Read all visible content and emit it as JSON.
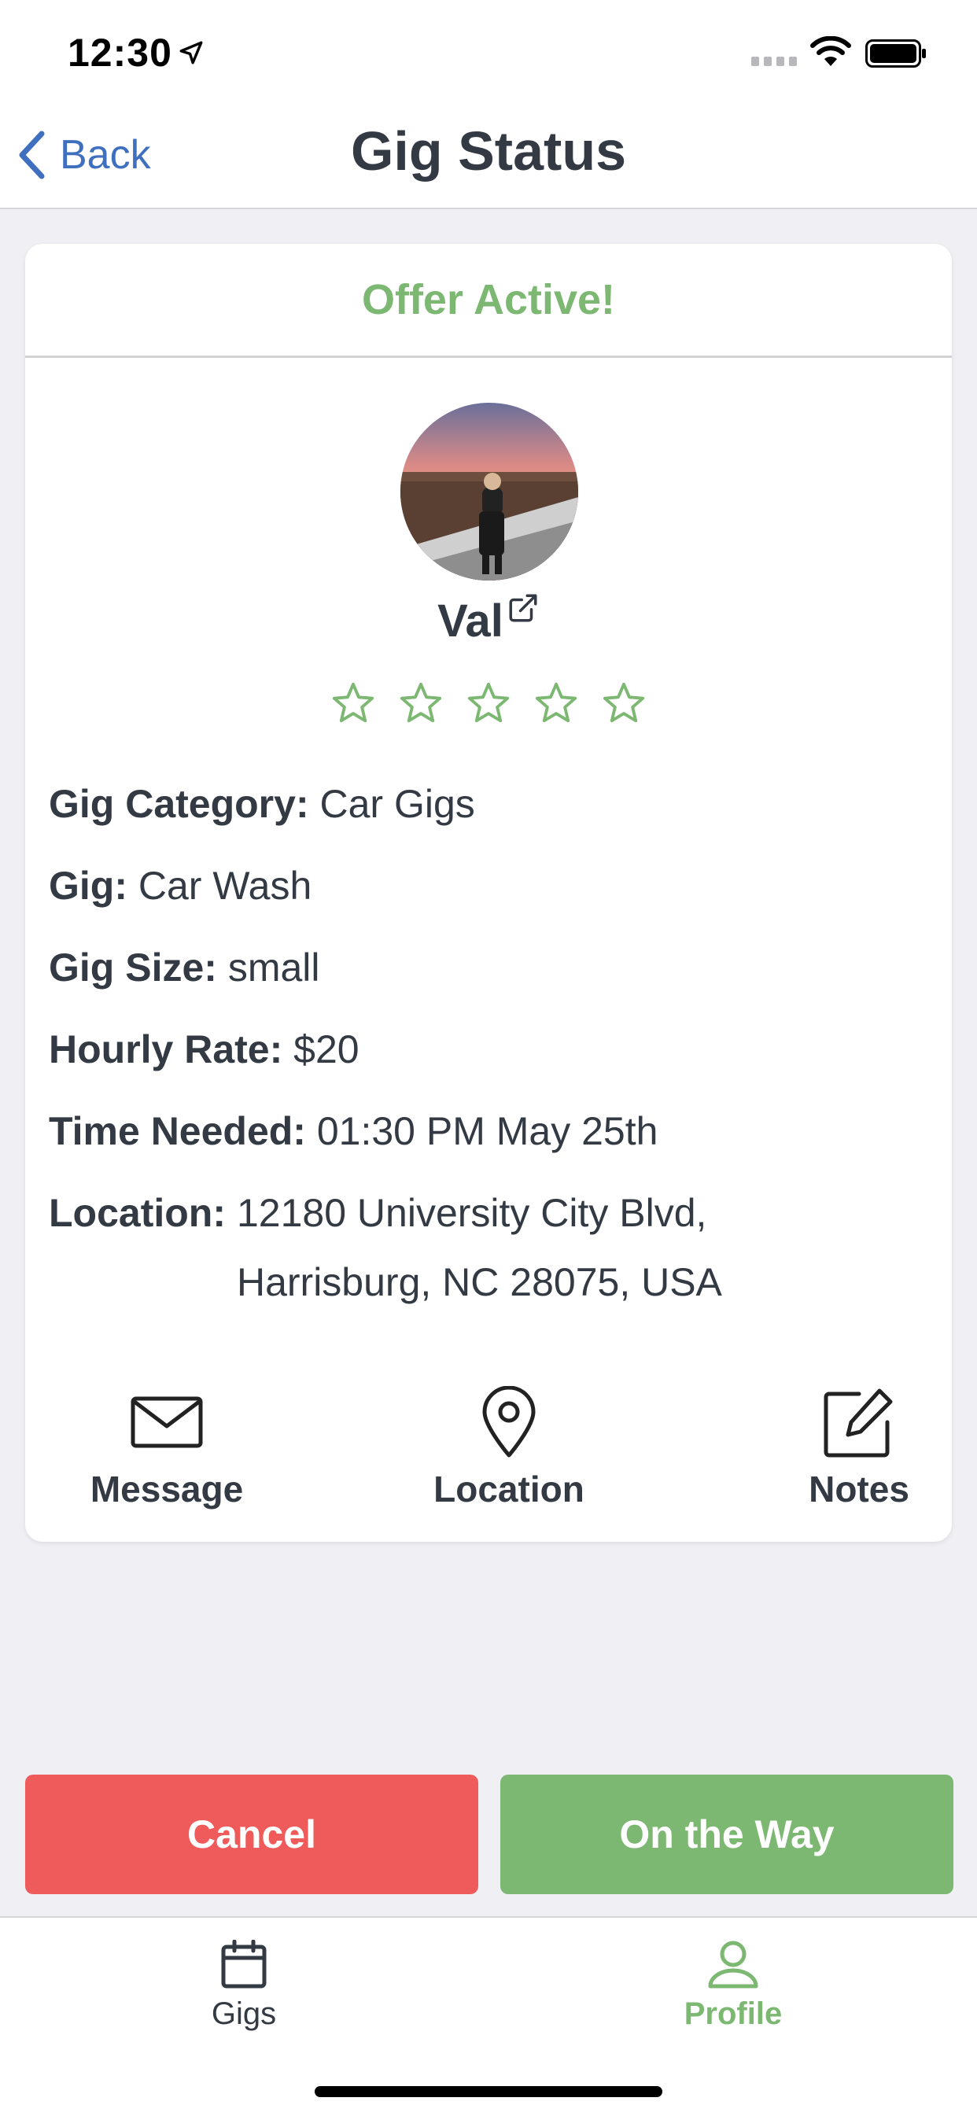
{
  "status_bar": {
    "time": "12:30"
  },
  "nav": {
    "back_label": "Back",
    "title": "Gig Status"
  },
  "card": {
    "header": "Offer Active!",
    "user_name": "Val",
    "rating": {
      "value": 0,
      "max": 5
    },
    "details": [
      {
        "key": "Gig Category:",
        "value": "Car Gigs"
      },
      {
        "key": "Gig:",
        "value": "Car Wash"
      },
      {
        "key": "Gig Size:",
        "value": "small"
      },
      {
        "key": "Hourly Rate:",
        "value": "$20"
      },
      {
        "key": "Time Needed:",
        "value": "01:30 PM May 25th"
      }
    ],
    "location": {
      "key": "Location:",
      "value": "12180 University City Blvd, Harrisburg, NC 28075, USA"
    },
    "actions": {
      "message": "Message",
      "location": "Location",
      "notes": "Notes"
    }
  },
  "buttons": {
    "cancel": "Cancel",
    "on_the_way": "On the Way"
  },
  "tabs": {
    "gigs": "Gigs",
    "profile": "Profile"
  },
  "colors": {
    "accent_green": "#7cb872",
    "cancel_red": "#ef5b5b",
    "link_blue": "#3f6fbf",
    "text_dark": "#333a44"
  }
}
